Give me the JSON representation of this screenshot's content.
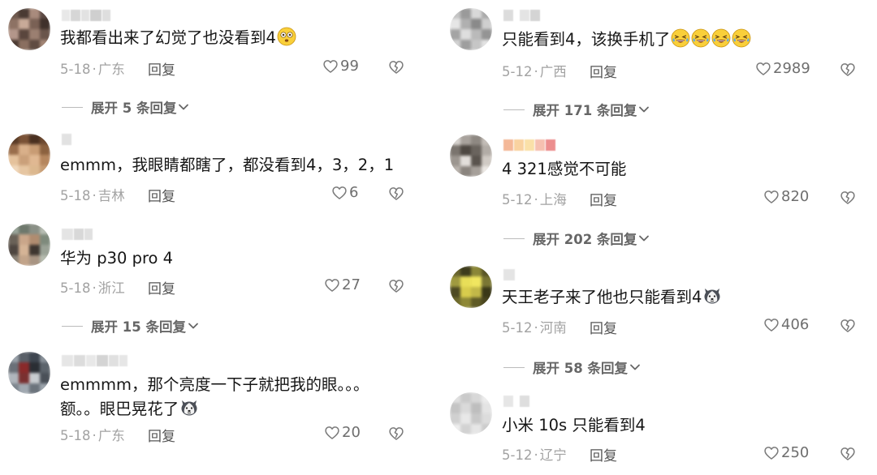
{
  "comments_left": [
    {
      "text": "我都看出来了幻觉了也没看到4",
      "emoji": "dizzy-face",
      "date": "5-18",
      "region": "广东",
      "reply": "回复",
      "likes": "99",
      "expand": "展开 5 条回复"
    },
    {
      "text": "emmm，我眼睛都瞎了，都没看到4，3，2，1",
      "date": "5-18",
      "region": "吉林",
      "reply": "回复",
      "likes": "6"
    },
    {
      "text": "华为 p30 pro   4",
      "date": "5-18",
      "region": "浙江",
      "reply": "回复",
      "likes": "27",
      "expand": "展开 15 条回复"
    },
    {
      "text": "emmmm，那个亮度一下子就把我的眼。。。额。。眼巴晃花了",
      "emoji": "husky",
      "date": "5-18",
      "region": "广东",
      "reply": "回复",
      "likes": "20"
    }
  ],
  "comments_right": [
    {
      "text": "只能看到4，该换手机了",
      "emoji": "laughing-x4",
      "date": "5-12",
      "region": "广西",
      "reply": "回复",
      "likes": "2989",
      "expand": "展开 171 条回复"
    },
    {
      "text": "4  321感觉不可能",
      "date": "5-12",
      "region": "上海",
      "reply": "回复",
      "likes": "820",
      "expand": "展开 202 条回复"
    },
    {
      "text": "天王老子来了他也只能看到4",
      "emoji": "husky",
      "date": "5-12",
      "region": "河南",
      "reply": "回复",
      "likes": "406",
      "expand": "展开 58 条回复"
    },
    {
      "text": "小米 10s 只能看到4",
      "date": "5-12",
      "region": "辽宁",
      "reply": "回复",
      "likes": "250"
    }
  ],
  "colors": {
    "text": "#161616",
    "meta": "#a2a2a2",
    "likes": "#6e6e6e",
    "expand": "#666666"
  },
  "icons": [
    "heart-outline-icon",
    "broken-heart-icon",
    "chevron-down-icon",
    "dizzy-face-emoji",
    "husky-emoji",
    "laughing-emoji"
  ]
}
